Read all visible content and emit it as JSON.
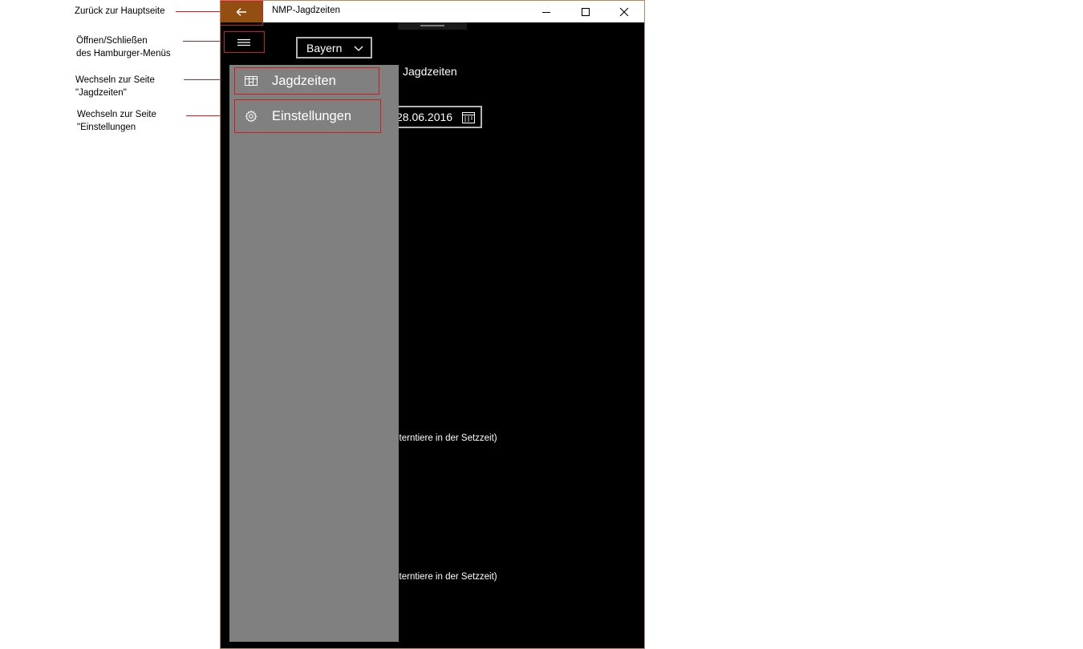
{
  "annotations": {
    "back": "Zurück zur Hauptseite",
    "hamburger_line1": "Öffnen/Schließen",
    "hamburger_line2": "des Hamburger-Menüs",
    "jagdzeiten_line1": "Wechseln zur Seite",
    "jagdzeiten_line2": "\"Jagdzeiten\"",
    "einstellungen_line1": "Wechseln zur Seite",
    "einstellungen_line2": "\"Einstellungen"
  },
  "window": {
    "title": "NMP-Jagdzeiten",
    "back_icon": "arrow-left-icon",
    "controls": [
      "minimize-icon",
      "maximize-icon",
      "close-icon"
    ]
  },
  "toolbar": {
    "hamburger_icon": "hamburger-icon",
    "region_value": "Bayern"
  },
  "content": {
    "heading": "Jagdzeiten",
    "date_value": "28.06.2016",
    "note_1": "lterntiere in der Setzzeit)",
    "note_2": "lterntiere in der Setzzeit)"
  },
  "nav_pane": {
    "items": [
      {
        "label": "Jagdzeiten",
        "icon": "calendar-grid-icon"
      },
      {
        "label": "Einstellungen",
        "icon": "gear-icon"
      }
    ]
  },
  "colors": {
    "back_button": "#934f11",
    "highlight_border": "#d11c1c",
    "pane_background": "#808080",
    "app_background": "#000000"
  }
}
